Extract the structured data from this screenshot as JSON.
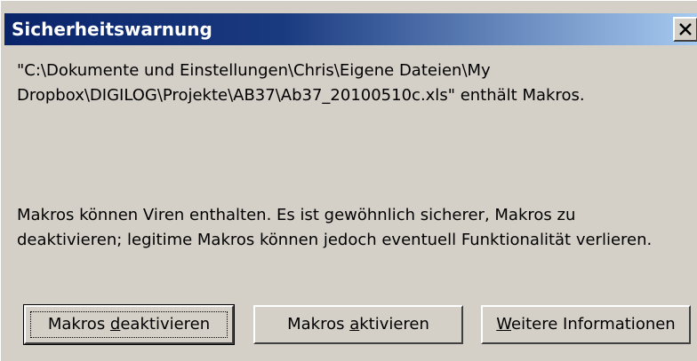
{
  "dialog": {
    "title": "Sicherheitswarnung",
    "close_glyph": "X",
    "message_line1": "\"C:\\Dokumente und Einstellungen\\Chris\\Eigene Dateien\\My",
    "message_line2": "Dropbox\\DIGILOG\\Projekte\\AB37\\Ab37_20100510c.xls\" enthält Makros.",
    "warning_line1": "Makros können Viren enthalten. Es ist gewöhnlich sicherer, Makros zu",
    "warning_line2": "deaktivieren; legitime Makros können jedoch eventuell Funktionalität verlieren."
  },
  "buttons": {
    "deactivate": {
      "pre": "Makros ",
      "accel": "d",
      "post": "eaktivieren"
    },
    "activate": {
      "pre": "Makros ",
      "accel": "a",
      "post": "ktivieren"
    },
    "more_info": {
      "pre": "",
      "accel": "W",
      "post": "eitere Informationen"
    }
  },
  "colors": {
    "title_bar_start": "#0a246a",
    "title_bar_end": "#a6caf0",
    "dialog_background": "#d4d0c8"
  }
}
